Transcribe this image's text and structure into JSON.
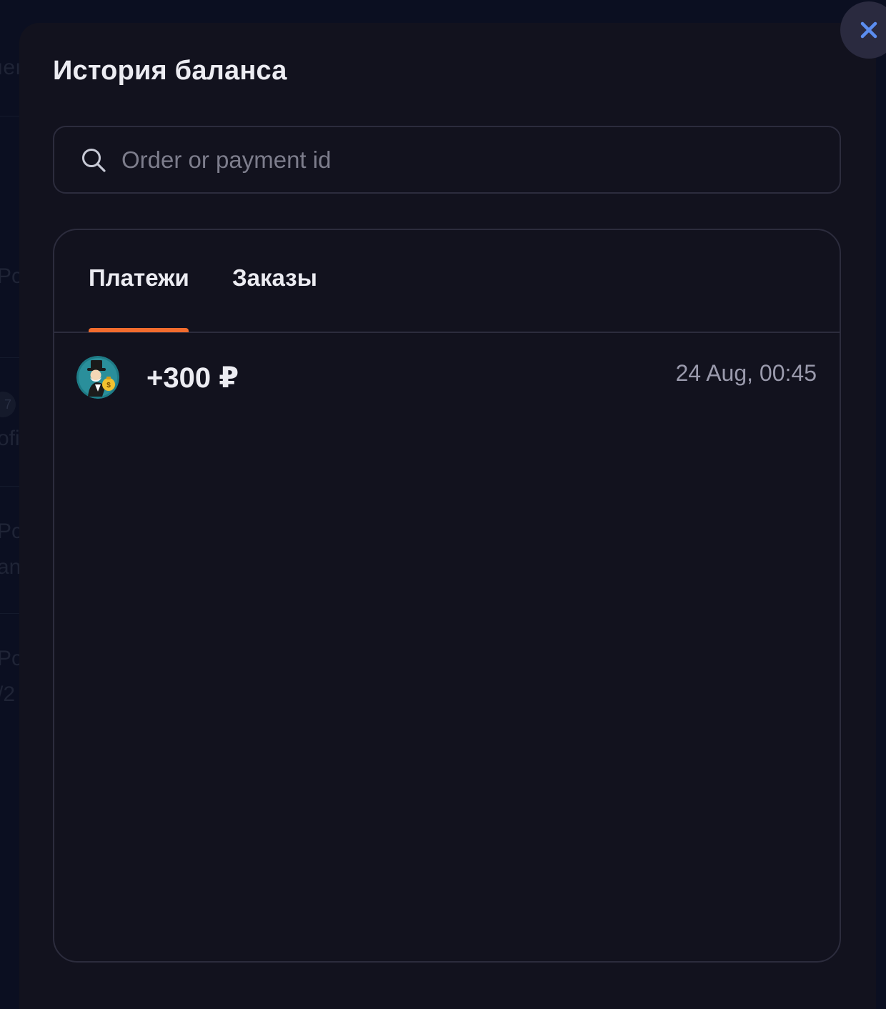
{
  "background": {
    "fragments": [
      "ıeı",
      "Pc",
      "7",
      "ofi",
      "Pc",
      "an",
      "Pc",
      "/2"
    ]
  },
  "modal": {
    "title": "История баланса",
    "close_icon": "close-icon"
  },
  "search": {
    "placeholder": "Order or payment id",
    "value": "",
    "icon": "search-icon"
  },
  "tabs": [
    {
      "label": "Платежи",
      "active": true
    },
    {
      "label": "Заказы",
      "active": false
    }
  ],
  "payments": [
    {
      "amount": "+300 ₽",
      "date": "24 Aug, 00:45",
      "icon": "payment-method-icon"
    }
  ],
  "colors": {
    "page_bg": "#0b0f21",
    "modal_bg": "#12121e",
    "border": "#2c2c3d",
    "accent": "#f26c2e",
    "close_icon": "#5b8def",
    "text": "#ececf2",
    "muted": "#9a9aac"
  }
}
